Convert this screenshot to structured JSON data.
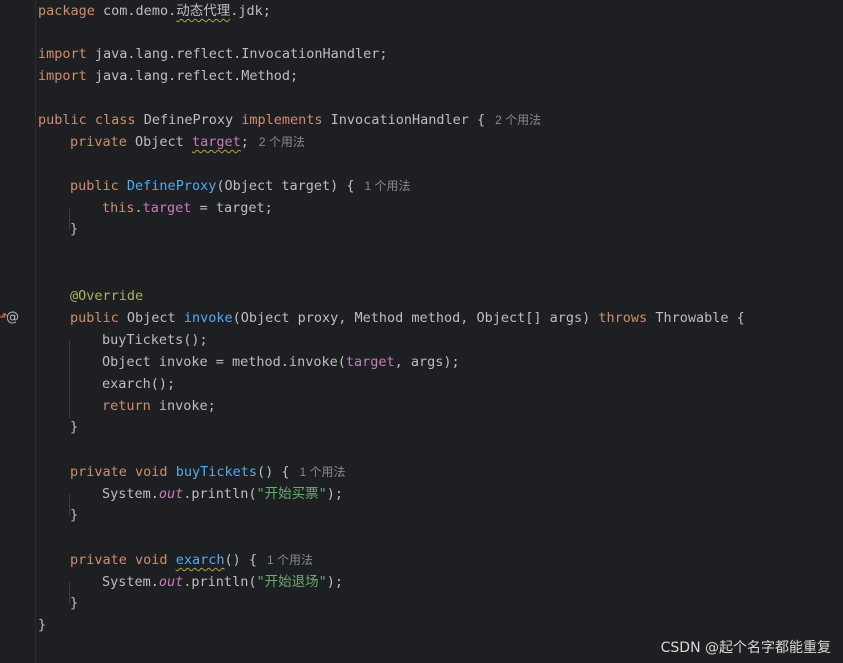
{
  "editor": {
    "lines": {
      "package": {
        "kw": "package",
        "path": "com.demo.",
        "pkg_cn": "动态代理",
        "rest": ".jdk;"
      },
      "import1": {
        "kw": "import",
        "path": "java.lang.reflect.InvocationHandler;"
      },
      "import2": {
        "kw": "import",
        "path": "java.lang.reflect.Method;"
      },
      "class_decl": {
        "kw1": "public",
        "kw2": "class",
        "name": "DefineProxy",
        "kw3": "implements",
        "iface": "InvocationHandler",
        "brace": "{",
        "hint": "2 个用法"
      },
      "field_decl": {
        "kw": "private",
        "type": "Object",
        "name": "target",
        "semi": ";",
        "hint": "2 个用法"
      },
      "ctor_decl": {
        "kw": "public",
        "name": "DefineProxy",
        "params": "(Object target) {",
        "hint": "1 个用法"
      },
      "ctor_body": {
        "kw": "this",
        "dot": ".",
        "field": "target",
        "rest": " = target;"
      },
      "ctor_close": "}",
      "override": "@Override",
      "invoke_decl": {
        "kw": "public",
        "type": "Object",
        "name": "invoke",
        "params": "(Object proxy, Method method, Object[] args)",
        "kw2": "throws",
        "exc": "Throwable {"
      },
      "invoke_l1": "buyTickets();",
      "invoke_l2": {
        "pre": "Object invoke = method.invoke(",
        "field": "target",
        "post": ", args);"
      },
      "invoke_l3": "exarch();",
      "invoke_l4": {
        "kw": "return",
        "rest": " invoke;"
      },
      "invoke_close": "}",
      "buy_decl": {
        "kw1": "private",
        "kw2": "void",
        "name": "buyTickets",
        "rest": "() {",
        "hint": "1 个用法"
      },
      "buy_body": {
        "pre": "System.",
        "static": "out",
        "mid": ".println(",
        "str": "\"开始买票\"",
        "post": ");"
      },
      "buy_close": "}",
      "exarch_decl": {
        "kw1": "private",
        "kw2": "void",
        "name": "exarch",
        "rest": "() {",
        "hint": "1 个用法"
      },
      "exarch_body": {
        "pre": "System.",
        "static": "out",
        "mid": ".println(",
        "str": "\"开始退场\"",
        "post": ");"
      },
      "exarch_close": "}",
      "class_close": "}"
    },
    "gutter": {
      "override_icon": "override-arrow-icon",
      "at_icon": "at-icon",
      "override_glyph": "⬏",
      "at_glyph": "@"
    }
  },
  "watermark": {
    "text": "CSDN @起个名字都能重复"
  },
  "colors": {
    "background": "#1e1f22",
    "keyword": "#cf8e6d",
    "method": "#56a8f5",
    "field": "#c77dbb",
    "string": "#6aab73",
    "annotation": "#b3ae60"
  }
}
